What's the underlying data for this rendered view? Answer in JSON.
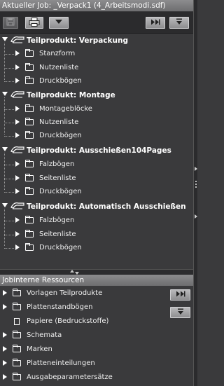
{
  "header": {
    "title": "Aktueller Job: _Verpack1 (4_Arbeitsmodi.sdf)"
  },
  "toolbar": {
    "buttons": [
      {
        "icon": "disk-icon",
        "state": "disabled"
      },
      {
        "icon": "printer-icon",
        "state": "enabled"
      },
      {
        "icon": "dropdown-triangle-icon",
        "state": "enabled"
      },
      {
        "icon": "fast-forward-icon",
        "state": "enabled"
      },
      {
        "icon": "collapse-down-icon",
        "state": "enabled"
      }
    ]
  },
  "tree": {
    "groups": [
      {
        "label": "Teilprodukt: Verpackung",
        "children": [
          "Stanzform",
          "Nutzenliste",
          "Druckbögen"
        ]
      },
      {
        "label": "Teilprodukt: Montage",
        "children": [
          "Montageblöcke",
          "Nutzenliste",
          "Druckbögen"
        ]
      },
      {
        "label": "Teilprodukt: Ausschießen104Pages",
        "children": [
          "Falzbögen",
          "Seitenliste",
          "Druckbögen"
        ]
      },
      {
        "label": "Teilprodukt: Automatisch Ausschießen",
        "children": [
          "Falzbögen",
          "Seitenliste",
          "Druckbögen"
        ]
      }
    ]
  },
  "resources": {
    "title": "Jobinterne Ressourcen",
    "items": [
      {
        "label": "Vorlagen Teilprodukte",
        "icon": "folder-icon",
        "expandable": true
      },
      {
        "label": "Plattenstandbögen",
        "icon": "folder-icon",
        "expandable": true
      },
      {
        "label": "Papiere (Bedruckstoffe)",
        "icon": "paper-icon",
        "expandable": false
      },
      {
        "label": "Schemata",
        "icon": "folder-icon",
        "expandable": true
      },
      {
        "label": "Marken",
        "icon": "folder-icon",
        "expandable": true
      },
      {
        "label": "Platteneinteilungen",
        "icon": "folder-icon",
        "expandable": true
      },
      {
        "label": "Ausgabeparametersätze",
        "icon": "folder-icon",
        "expandable": true
      }
    ]
  },
  "colors": {
    "panel": "#3a3a3c",
    "header": "#7d7d7f",
    "text": "#f0f0f0",
    "button": "#a5a5a7"
  }
}
